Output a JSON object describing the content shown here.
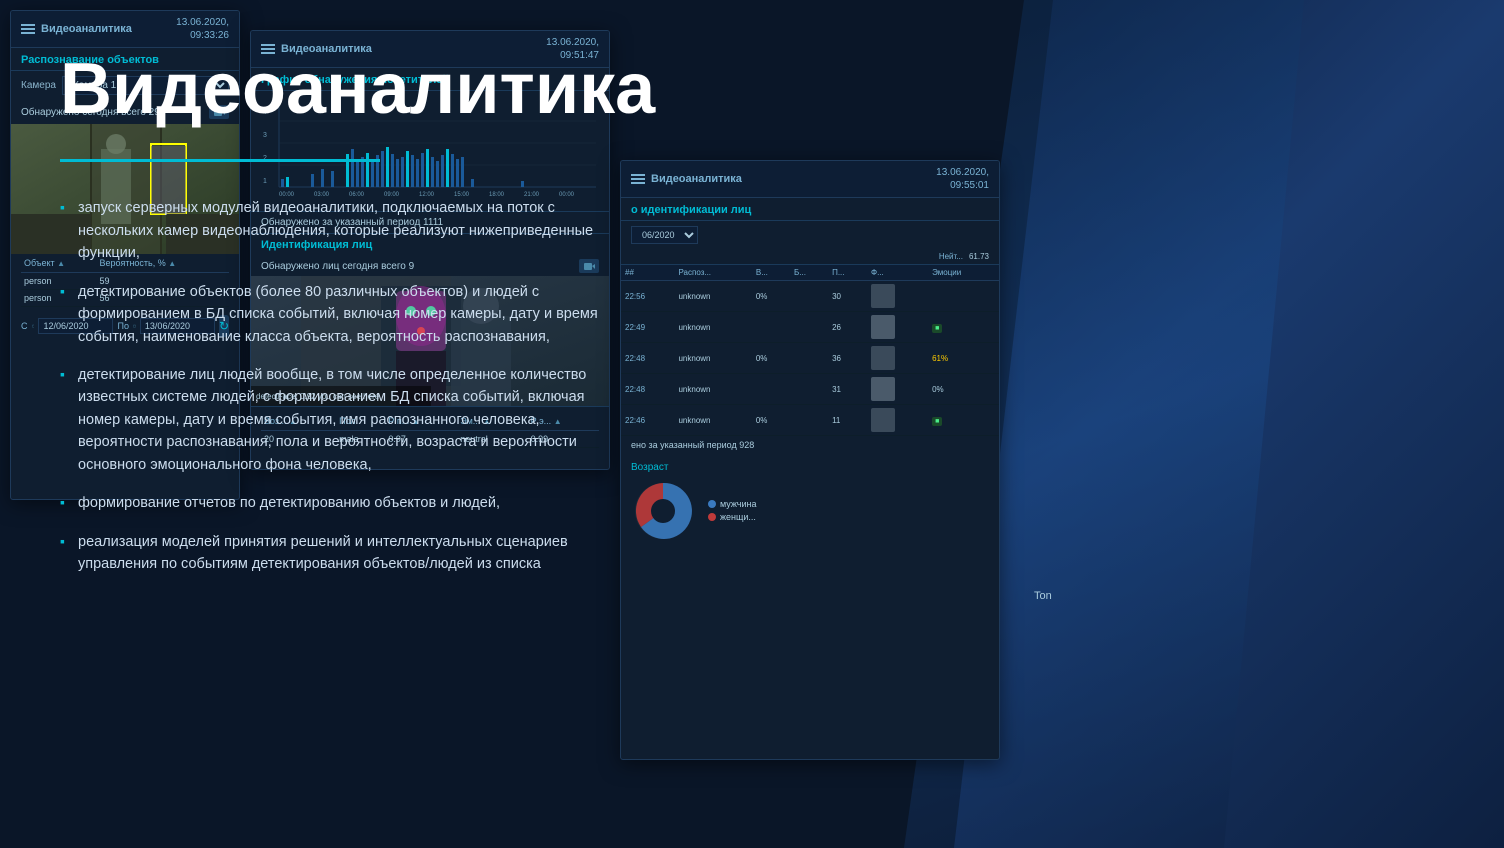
{
  "page": {
    "title": "Видеоаналитика",
    "background_color": "#0a1628"
  },
  "left_panel": {
    "main_title": "Видеоаналитика",
    "bullets": [
      "запуск серверных модулей видеоаналитики, подключаемых на поток с нескольких камер видеонаблюдения, которые реализуют нижеприведенные функции,",
      "детектирование объектов (более 80 различных объектов) и людей с формированием в БД списка событий, включая номер камеры, дату и время события, наименование класса объекта, вероятность распознавания,",
      "детектирование лиц людей вообще, в том числе определенное количество известных системе людей, с формированием БД списка событий, включая номер камеры, дату и время события, имя распознанного человека, вероятности распознавания, пола и вероятности, возраста и вероятности основного эмоционального фона человека,",
      "формирование отчетов по детектированию объектов и людей,",
      "реализация моделей принятия решений и интеллектуальных сценариев управления по событиям детектирования объектов/людей из списка"
    ]
  },
  "panel1": {
    "title": "Видеоаналитика",
    "date": "13.06.2020,",
    "time": "09:33:26",
    "section_title": "Распознавание объектов",
    "camera_label": "Камера",
    "camera_value": "Камера 1",
    "detected_text": "Обнаружено сегодня всего 29",
    "table": {
      "headers": [
        "Объект",
        "Вероятность, %"
      ],
      "rows": [
        [
          "person",
          "59"
        ],
        [
          "person",
          "56"
        ]
      ]
    },
    "date_from_label": "С",
    "date_from": "12/06/2020",
    "date_to_label": "По",
    "date_to": "13/06/2020"
  },
  "panel2": {
    "title": "Видеоаналитика",
    "date": "13.06.2020,",
    "time": "09:51:47",
    "section_title": "График обнаружения посетителей",
    "y_labels": [
      "4",
      "3",
      "2",
      "1"
    ],
    "x_labels": [
      "00:00",
      "03:00",
      "06:00",
      "09:00",
      "12:00",
      "15:00",
      "18:00",
      "21:00",
      "00:00"
    ],
    "period_detected": "Обнаружено за указанный период 1111",
    "face_id_title": "Идентификация лиц",
    "face_detected": "Обнаружено лиц сегодня всего 9",
    "face_attr_headers": [
      "Воз...",
      "Пол",
      "Р п...",
      "Эм...",
      "Р э..."
    ],
    "face_attr_row": [
      "20",
      "male",
      "0.97",
      "neutral",
      "0.99"
    ]
  },
  "panel3": {
    "title": "Видеоаналитика",
    "date": "13.06.2020,",
    "time": "09:55:01",
    "section_title": "о идентификации лиц",
    "filter_label": "06/2020",
    "neutral_label": "Нейт...",
    "neutral_val": "61.73",
    "table_headers": [
      "##",
      "Распоз...",
      "В...",
      "Б...",
      "П...",
      "Ф...",
      "Эмоции"
    ],
    "table_rows": [
      {
        "time": "22:56",
        "name": "unknown",
        "v1": "0%",
        "v2": "",
        "v3": "30",
        "emotion": ""
      },
      {
        "time": "22:49",
        "name": "unknown",
        "v1": "",
        "v2": "",
        "v3": "26",
        "emotion": "green"
      },
      {
        "time": "22:48",
        "name": "unknown",
        "v1": "0%",
        "v2": "",
        "v3": "36",
        "emotion": "61%"
      },
      {
        "time": "22:48",
        "name": "unknown",
        "v1": "",
        "v2": "",
        "v3": "31",
        "emotion": "0%"
      },
      {
        "time": "22:46",
        "name": "unknown",
        "v1": "0%",
        "v2": "",
        "v3": "11",
        "emotion": "green"
      }
    ],
    "period_detected": "ено за указанный период 928",
    "age_title": "Возраст",
    "legend": [
      {
        "label": "мужчина",
        "color": "#3a7abf"
      },
      {
        "label": "женщи...",
        "color": "#bf3a3a"
      }
    ]
  }
}
